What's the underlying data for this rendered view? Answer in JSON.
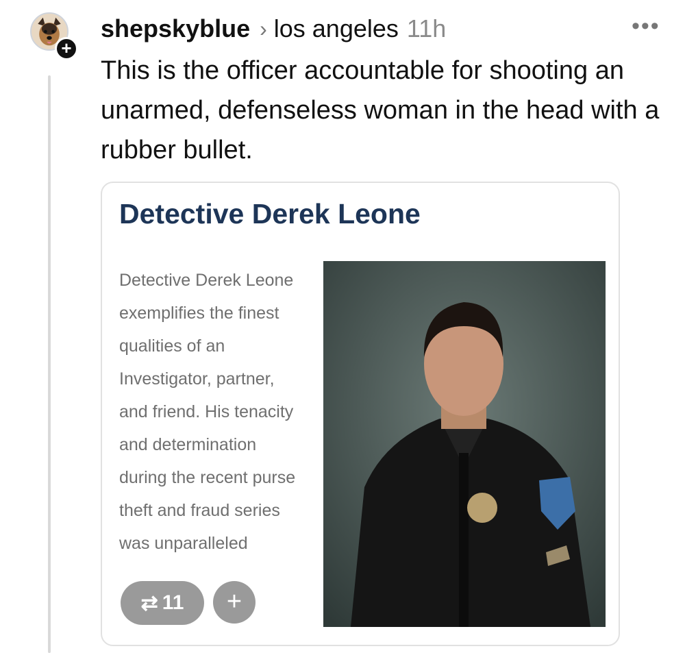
{
  "post": {
    "username": "shepskyblue",
    "community": "los angeles",
    "time": "11h",
    "more_label": "•••",
    "text": "This is the officer accountable for shooting an unarmed, defenseless woman in the head with a rubber bullet."
  },
  "card": {
    "title": "Detective Derek Leone",
    "description": "Detective Derek Leone exemplifies the finest qualities of an Investigator, partner, and friend. His tenacity and determination during the recent purse theft and fraud series was unparalleled"
  },
  "actions": {
    "repost_icon": "repost-icon",
    "repost_count": "11",
    "add_label": "+"
  },
  "follow_badge": "+",
  "colors": {
    "title": "#1d3557",
    "desc": "#6f6f6f",
    "time": "#8a8a8a"
  }
}
